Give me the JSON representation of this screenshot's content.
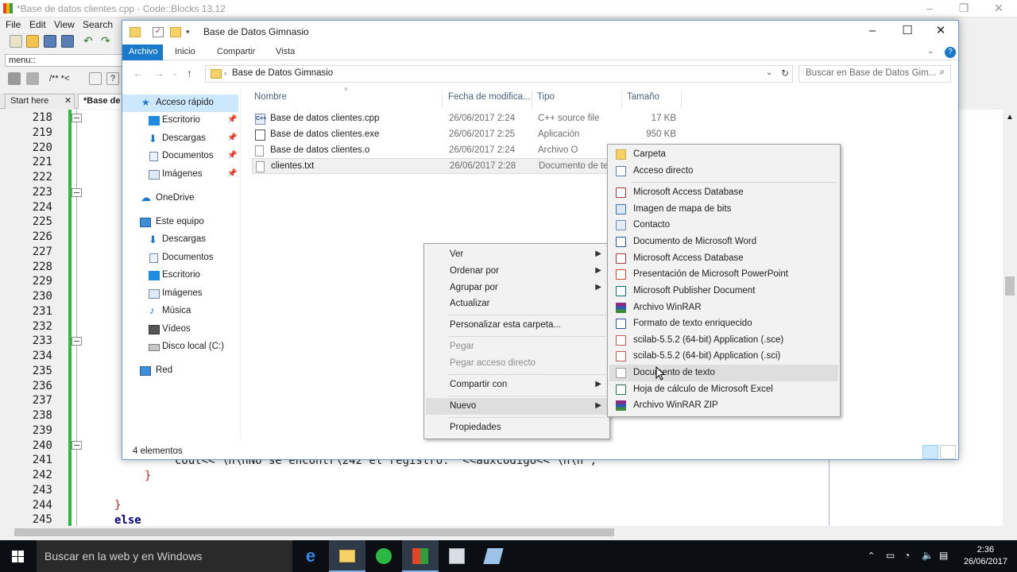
{
  "codeblocks": {
    "title": "*Base de datos clientes.cpp - Code::Blocks 13.12",
    "menu": [
      "File",
      "Edit",
      "View",
      "Search"
    ],
    "target_combo": "menu::",
    "tabs": [
      "Start here",
      "*Base de"
    ],
    "line_numbers": [
      "218",
      "219",
      "220",
      "221",
      "222",
      "223",
      "224",
      "225",
      "226",
      "227",
      "228",
      "229",
      "230",
      "231",
      "232",
      "233",
      "234",
      "235",
      "236",
      "237",
      "238",
      "239",
      "240",
      "241",
      "242",
      "243",
      "244",
      "245"
    ],
    "code_line_241": "cout<<\"\\n\\nNo se encontr\\242 el registro: \"<<auxcodigo<<\"\\n\\n\";",
    "code_line_242": "}",
    "code_line_244": "}",
    "code_line_245": "else"
  },
  "explorer": {
    "title": "Base de Datos Gimnasio",
    "ribbon_tabs": [
      "Archivo",
      "Inicio",
      "Compartir",
      "Vista"
    ],
    "address": "Base de Datos Gimnasio",
    "search_placeholder": "Buscar en Base de Datos Gim...",
    "nav": {
      "quick_access": "Acceso rápido",
      "quick_items": [
        "Escritorio",
        "Descargas",
        "Documentos",
        "Imágenes"
      ],
      "onedrive": "OneDrive",
      "this_pc": "Este equipo",
      "pc_items": [
        "Descargas",
        "Documentos",
        "Escritorio",
        "Imágenes",
        "Música",
        "Vídeos",
        "Disco local (C:)"
      ],
      "network": "Red"
    },
    "columns": {
      "name": "Nombre",
      "date": "Fecha de modifica...",
      "type": "Tipo",
      "size": "Tamaño"
    },
    "files": [
      {
        "name": "Base de datos clientes.cpp",
        "date": "26/06/2017 2:24",
        "type": "C++ source file",
        "size": "17 KB"
      },
      {
        "name": "Base de datos clientes.exe",
        "date": "26/06/2017 2:25",
        "type": "Aplicación",
        "size": "950 KB"
      },
      {
        "name": "Base de datos clientes.o",
        "date": "26/06/2017 2:24",
        "type": "Archivo O",
        "size": ""
      },
      {
        "name": "clientes.txt",
        "date": "26/06/2017 2:28",
        "type": "Documento de te",
        "size": ""
      }
    ],
    "status": "4 elementos"
  },
  "context_menu": {
    "items": [
      "Ver",
      "Ordenar por",
      "Agrupar por",
      "Actualizar",
      "Personalizar esta carpeta...",
      "Pegar",
      "Pegar acceso directo",
      "Compartir con",
      "Nuevo",
      "Propiedades"
    ]
  },
  "new_submenu": {
    "items": [
      "Carpeta",
      "Acceso directo",
      "Microsoft Access Database",
      "Imagen de mapa de bits",
      "Contacto",
      "Documento de Microsoft Word",
      "Microsoft Access Database",
      "Presentación de Microsoft PowerPoint",
      "Microsoft Publisher Document",
      "Archivo WinRAR",
      "Formato de texto enriquecido",
      "scilab-5.5.2 (64-bit) Application (.sce)",
      "scilab-5.5.2 (64-bit) Application (.sci)",
      "Documento de texto",
      "Hoja de cálculo de Microsoft Excel",
      "Archivo WinRAR ZIP"
    ],
    "highlighted": "Documento de texto"
  },
  "taskbar": {
    "search": "Buscar en la web y en Windows",
    "time": "2:36",
    "date": "26/06/2017"
  },
  "colors": {
    "accent": "#1979ca",
    "change_bar": "#2dbb3f",
    "taskbar": "#0b0f14",
    "selection": "#cce8ff"
  }
}
